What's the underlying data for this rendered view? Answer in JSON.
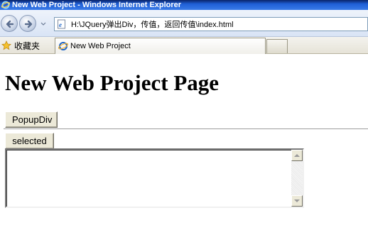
{
  "window": {
    "title": "New Web Project - Windows Internet Explorer"
  },
  "toolbar": {
    "address": "H:\\JQuery弹出Div，传值，返回传值\\index.html"
  },
  "favorites": {
    "label": "收藏夹"
  },
  "tabs": [
    {
      "label": "New Web Project"
    }
  ],
  "page": {
    "heading": "New Web Project Page",
    "popup_button": "PopupDiv",
    "selected_button": "selected",
    "textarea_value": ""
  }
}
